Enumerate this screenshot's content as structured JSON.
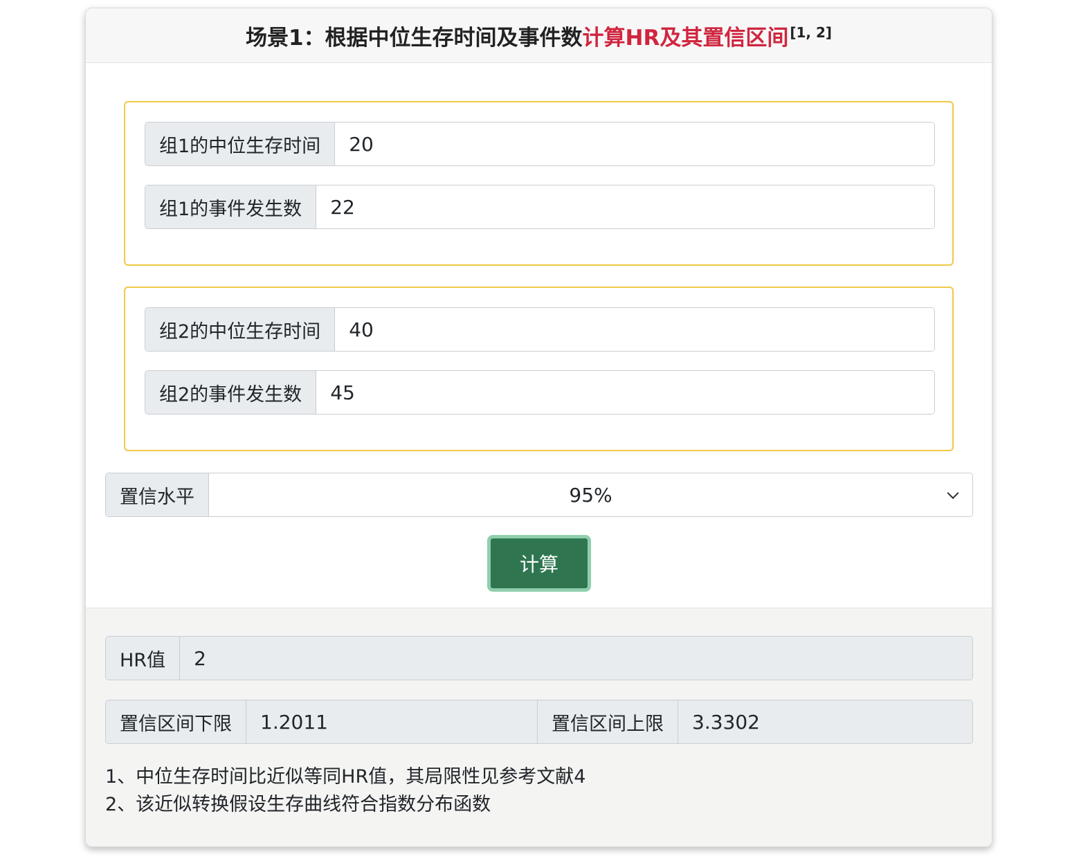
{
  "header": {
    "title_prefix": "场景1：根据中位生存时间及事件数",
    "title_highlight": "计算HR及其置信区间",
    "title_sup": "[1, 2]"
  },
  "group1": {
    "median_label": "组1的中位生存时间",
    "median_value": "20",
    "events_label": "组1的事件发生数",
    "events_value": "22"
  },
  "group2": {
    "median_label": "组2的中位生存时间",
    "median_value": "40",
    "events_label": "组2的事件发生数",
    "events_value": "45"
  },
  "confidence": {
    "label": "置信水平",
    "selected": "95%"
  },
  "calculate_label": "计算",
  "results": {
    "hr_label": "HR值",
    "hr_value": "2",
    "lower_label": "置信区间下限",
    "lower_value": "1.2011",
    "upper_label": "置信区间上限",
    "upper_value": "3.3302"
  },
  "notes": [
    "1、中位生存时间比近似等同HR值，其局限性见参考文献4",
    "2、该近似转换假设生存曲线符合指数分布函数"
  ],
  "colors": {
    "accent_red": "#d0253f",
    "group_border": "#f0c846",
    "button_green": "#2f7650"
  }
}
